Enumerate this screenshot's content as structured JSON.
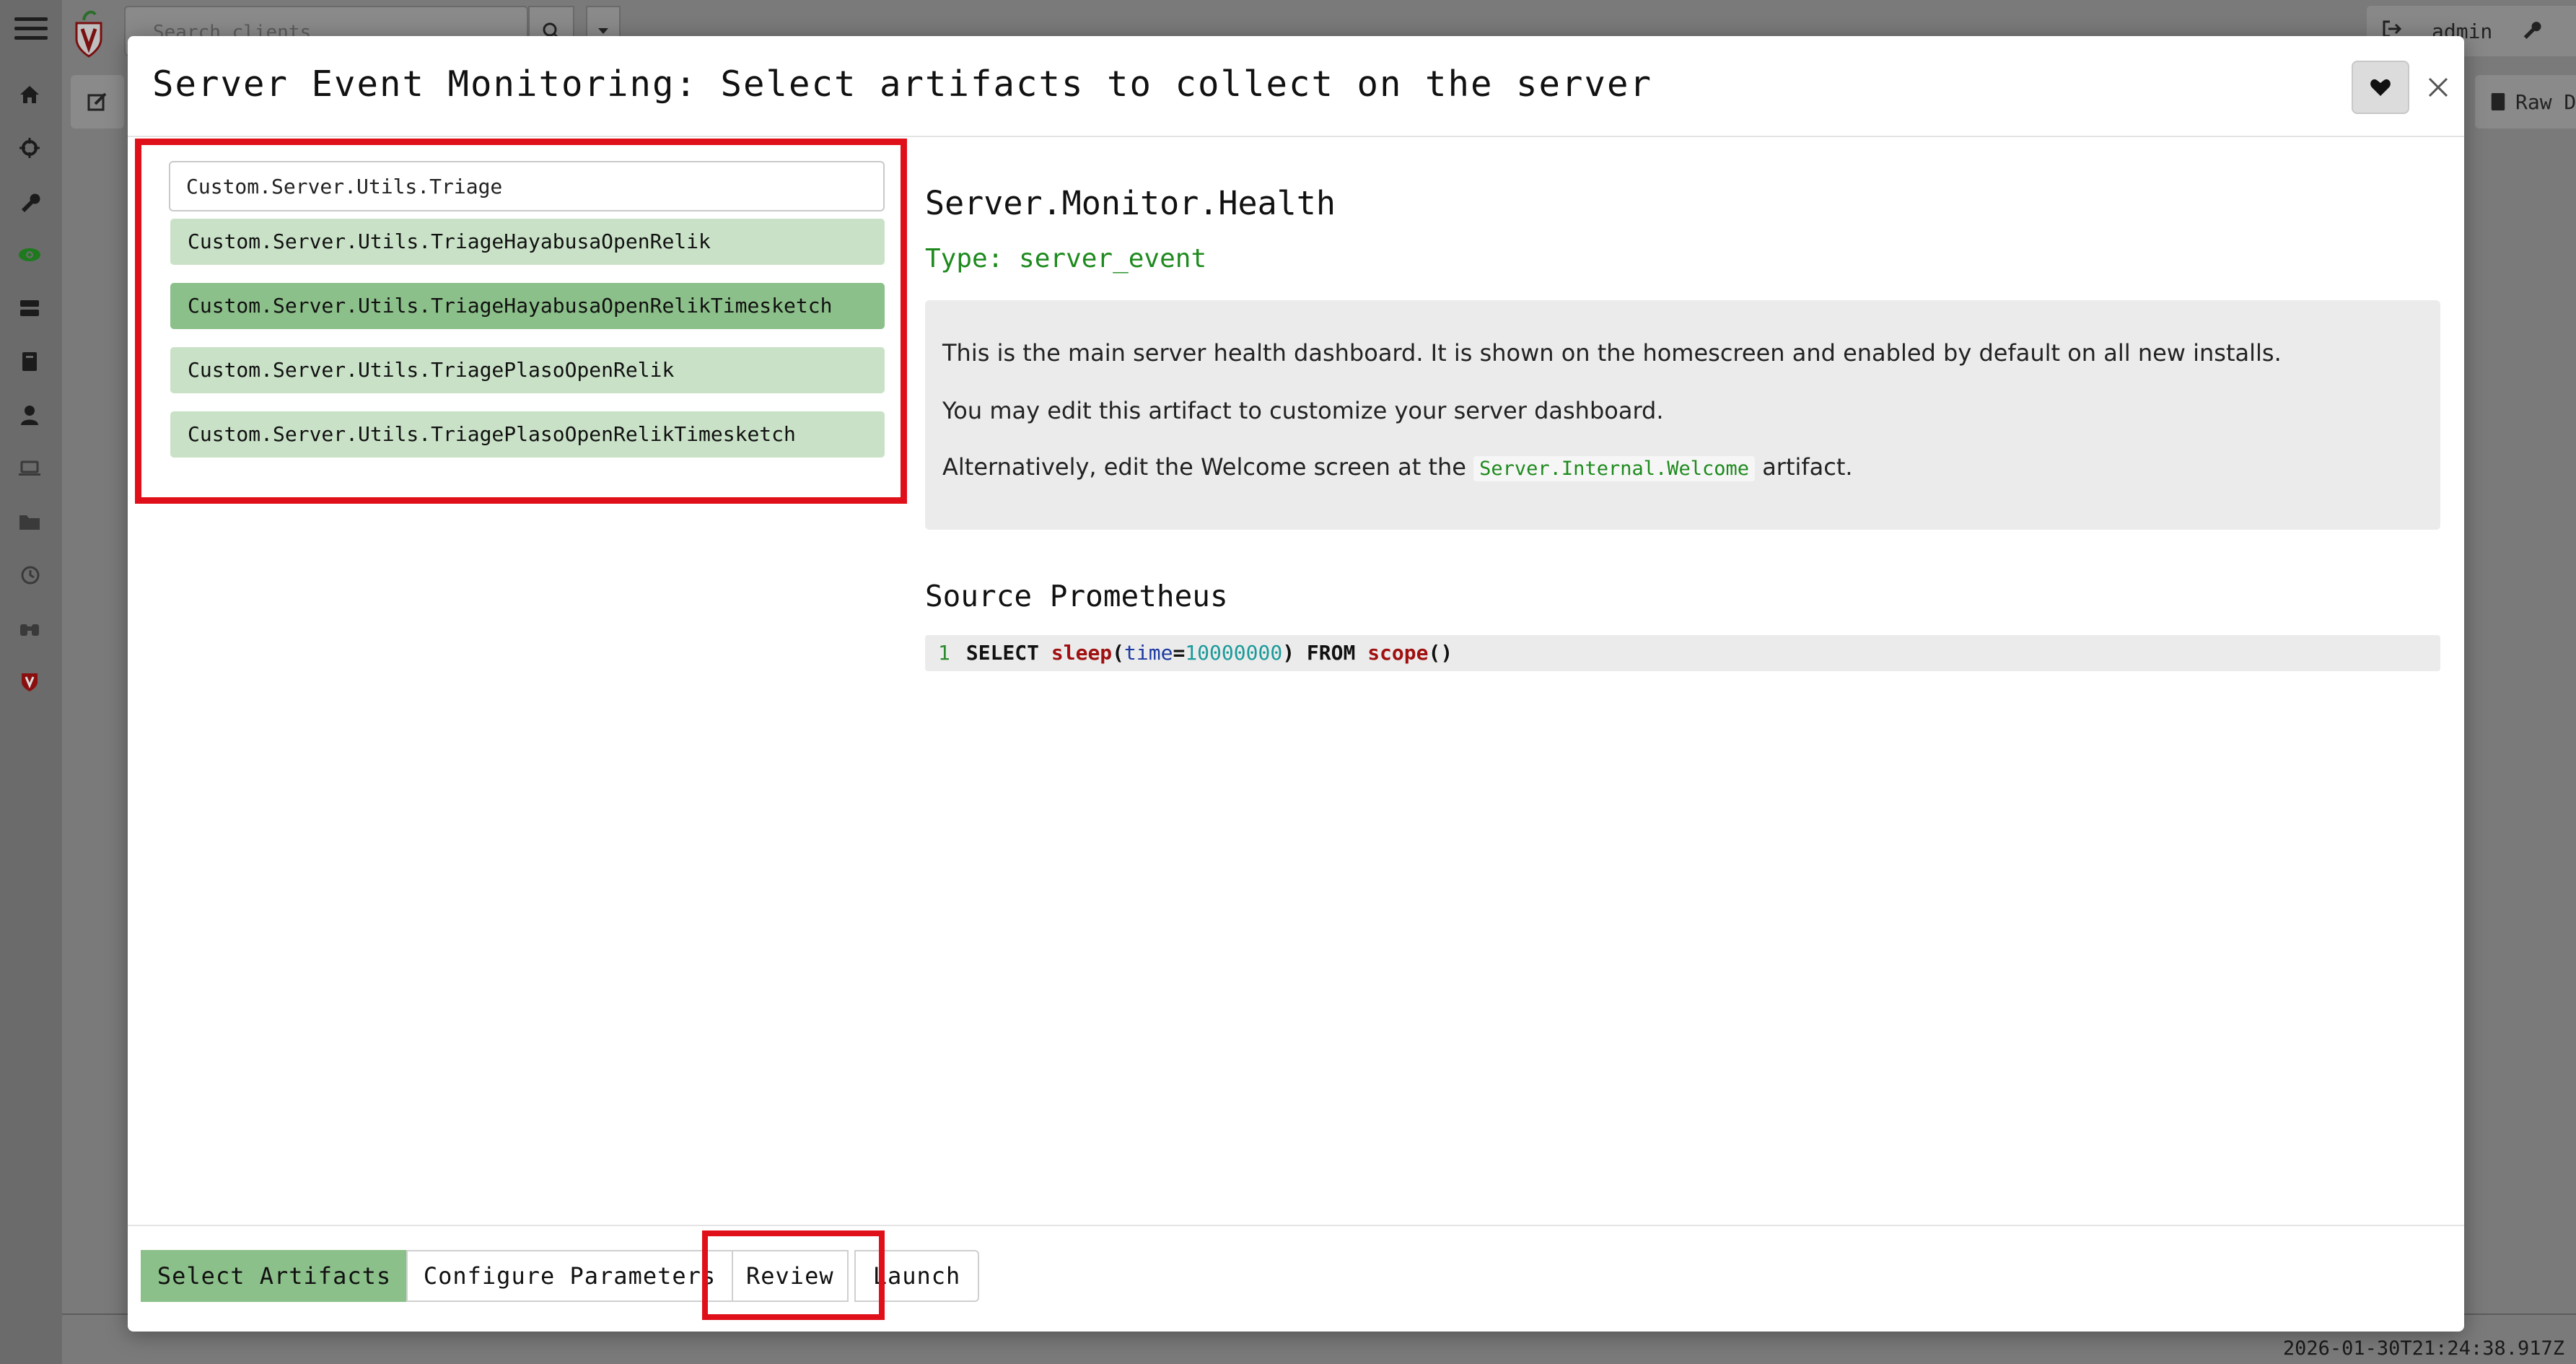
{
  "background": {
    "search_placeholder": "Search clients",
    "user_name": "admin",
    "raw_button_label": "Raw D",
    "timestamp": "2026-01-30T21:24:38.917Z"
  },
  "sidebar": {
    "items": [
      {
        "icon": "home-icon"
      },
      {
        "icon": "crosshair-icon"
      },
      {
        "icon": "wrench-icon"
      },
      {
        "icon": "eye-icon"
      },
      {
        "icon": "server-icon"
      },
      {
        "icon": "book-icon"
      },
      {
        "icon": "user-icon"
      },
      {
        "icon": "laptop-icon"
      },
      {
        "icon": "folder-icon"
      },
      {
        "icon": "history-icon"
      },
      {
        "icon": "binoculars-icon"
      },
      {
        "icon": "velociraptor-icon"
      }
    ]
  },
  "modal": {
    "title": "Server Event Monitoring: Select artifacts to collect on the server",
    "search": {
      "value": "Custom.Server.Utils.Triage",
      "placeholder": ""
    },
    "artifacts": [
      {
        "label": "Custom.Server.Utils.TriageHayabusaOpenRelik",
        "selected": false
      },
      {
        "label": "Custom.Server.Utils.TriageHayabusaOpenRelikTimesketch",
        "selected": true
      },
      {
        "label": "Custom.Server.Utils.TriagePlasoOpenRelik",
        "selected": false
      },
      {
        "label": "Custom.Server.Utils.TriagePlasoOpenRelikTimesketch",
        "selected": false
      }
    ],
    "detail": {
      "name": "Server.Monitor.Health",
      "type": "Type: server_event",
      "description": {
        "p1": "This is the main server health dashboard. It is shown on the homescreen and enabled by default on all new installs.",
        "p2": "You may edit this artifact to customize your server dashboard.",
        "p3_before": "Alternatively, edit the Welcome screen at the ",
        "p3_code": "Server.Internal.Welcome",
        "p3_after": " artifact."
      },
      "source_title": "Source Prometheus",
      "code": {
        "line_number": "1",
        "select": "SELECT",
        "fn1": "sleep",
        "paren_open": "(",
        "arg": "time",
        "eq": "=",
        "num": "10000000",
        "paren_close": ")",
        "from": "FROM",
        "fn2": "scope",
        "parens": "()"
      }
    },
    "steps": {
      "select": "Select Artifacts",
      "configure": "Configure Parameters",
      "review": "Review",
      "launch": "Launch"
    }
  },
  "colors": {
    "highlight": "#e0101a",
    "selected_item": "#8cc08a",
    "item": "#c9e2c7",
    "type_text": "#1e8a1e"
  }
}
